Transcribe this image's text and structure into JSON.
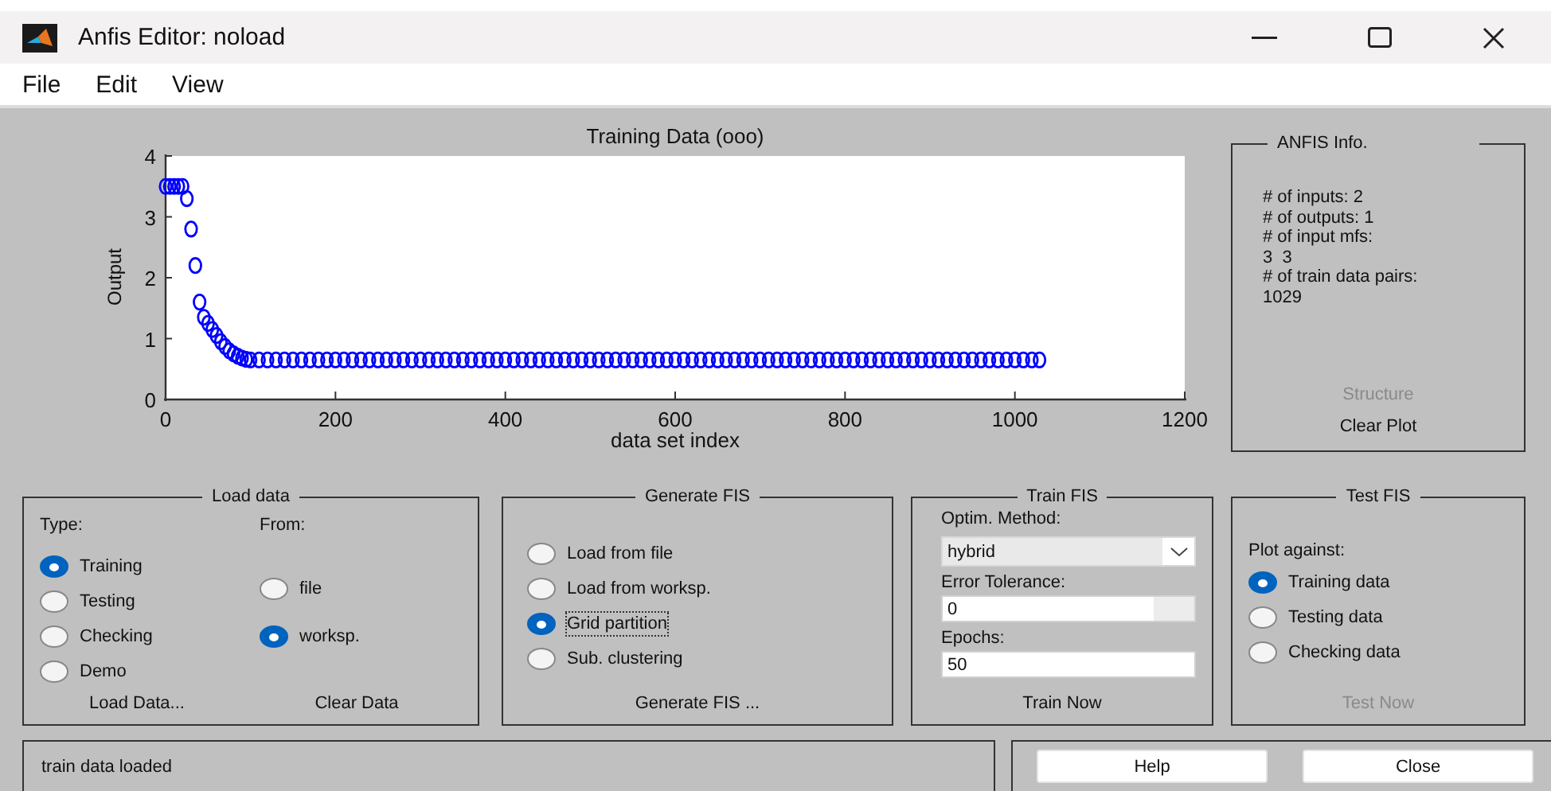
{
  "window": {
    "title": "Anfis Editor: noload"
  },
  "menu": [
    "File",
    "Edit",
    "View"
  ],
  "plot": {
    "chart_data": {
      "type": "scatter",
      "title": "Training Data (ooo)",
      "xlabel": "data set index",
      "ylabel": "Output",
      "xlim": [
        0,
        1200
      ],
      "ylim": [
        0,
        4
      ],
      "xticks": [
        0,
        200,
        400,
        600,
        800,
        1000,
        1200
      ],
      "yticks": [
        0,
        1,
        2,
        3,
        4
      ],
      "x": [
        0,
        5,
        10,
        15,
        20,
        25,
        30,
        35,
        40,
        45,
        50,
        55,
        60,
        65,
        70,
        75,
        80,
        85,
        90,
        95,
        100,
        110,
        120,
        130,
        140,
        150,
        160,
        170,
        180,
        190,
        200,
        210,
        220,
        230,
        240,
        250,
        260,
        270,
        280,
        290,
        300,
        310,
        320,
        330,
        340,
        350,
        360,
        370,
        380,
        390,
        400,
        410,
        420,
        430,
        440,
        450,
        460,
        470,
        480,
        490,
        500,
        510,
        520,
        530,
        540,
        550,
        560,
        570,
        580,
        590,
        600,
        610,
        620,
        630,
        640,
        650,
        660,
        670,
        680,
        690,
        700,
        710,
        720,
        730,
        740,
        750,
        760,
        770,
        780,
        790,
        800,
        810,
        820,
        830,
        840,
        850,
        860,
        870,
        880,
        890,
        900,
        910,
        920,
        930,
        940,
        950,
        960,
        970,
        980,
        990,
        1000,
        1010,
        1020,
        1029
      ],
      "series": [
        {
          "color": "#0000ff",
          "values": [
            3.5,
            3.5,
            3.5,
            3.5,
            3.5,
            3.3,
            2.8,
            2.2,
            1.6,
            1.35,
            1.25,
            1.15,
            1.05,
            0.95,
            0.87,
            0.8,
            0.75,
            0.71,
            0.68,
            0.66,
            0.65,
            0.65,
            0.65,
            0.65,
            0.65,
            0.65,
            0.65,
            0.65,
            0.65,
            0.65,
            0.65,
            0.65,
            0.65,
            0.65,
            0.65,
            0.65,
            0.65,
            0.65,
            0.65,
            0.65,
            0.65,
            0.65,
            0.65,
            0.65,
            0.65,
            0.65,
            0.65,
            0.65,
            0.65,
            0.65,
            0.65,
            0.65,
            0.65,
            0.65,
            0.65,
            0.65,
            0.65,
            0.65,
            0.65,
            0.65,
            0.65,
            0.65,
            0.65,
            0.65,
            0.65,
            0.65,
            0.65,
            0.65,
            0.65,
            0.65,
            0.65,
            0.65,
            0.65,
            0.65,
            0.65,
            0.65,
            0.65,
            0.65,
            0.65,
            0.65,
            0.65,
            0.65,
            0.65,
            0.65,
            0.65,
            0.65,
            0.65,
            0.65,
            0.65,
            0.65,
            0.65,
            0.65,
            0.65,
            0.65,
            0.65,
            0.65,
            0.65,
            0.65,
            0.65,
            0.65,
            0.65,
            0.65,
            0.65,
            0.65,
            0.65,
            0.65,
            0.65,
            0.65,
            0.65,
            0.65,
            0.65,
            0.65,
            0.65,
            0.65
          ]
        }
      ]
    }
  },
  "anfis_info": {
    "title": "ANFIS Info.",
    "lines": [
      "# of inputs: 2",
      "# of outputs: 1",
      "# of input mfs:",
      "3  3",
      "# of train data pairs:",
      "1029"
    ],
    "buttons": [
      {
        "label": "Structure",
        "disabled": true
      },
      {
        "label": "Clear Plot",
        "disabled": false
      }
    ]
  },
  "load_data": {
    "title": "Load data",
    "type_label": "Type:",
    "types": [
      {
        "label": "Training",
        "selected": true
      },
      {
        "label": "Testing",
        "selected": false
      },
      {
        "label": "Checking",
        "selected": false
      },
      {
        "label": "Demo",
        "selected": false
      }
    ],
    "from_label": "From:",
    "sources": [
      {
        "label": "file",
        "selected": false
      },
      {
        "label": "worksp.",
        "selected": true
      }
    ],
    "buttons": [
      {
        "label": "Load Data...",
        "disabled": false
      },
      {
        "label": "Clear Data",
        "disabled": false
      }
    ]
  },
  "generate_fis": {
    "title": "Generate FIS",
    "options": [
      {
        "label": "Load from file",
        "selected": false,
        "focused": false
      },
      {
        "label": "Load from worksp.",
        "selected": false,
        "focused": false
      },
      {
        "label": "Grid partition",
        "selected": true,
        "focused": true
      },
      {
        "label": "Sub. clustering",
        "selected": false,
        "focused": false
      }
    ],
    "button": {
      "label": "Generate FIS ...",
      "disabled": false
    }
  },
  "train_fis": {
    "title": "Train FIS",
    "method_label": "Optim. Method:",
    "method": "hybrid",
    "tolerance_label": "Error Tolerance:",
    "tolerance": "0",
    "epochs_label": "Epochs:",
    "epochs": "50",
    "button": {
      "label": "Train Now",
      "disabled": false
    }
  },
  "test_fis": {
    "title": "Test FIS",
    "plot_label": "Plot against:",
    "options": [
      {
        "label": "Training data",
        "selected": true
      },
      {
        "label": "Testing data",
        "selected": false
      },
      {
        "label": "Checking data",
        "selected": false
      }
    ],
    "button": {
      "label": "Test Now",
      "disabled": true
    }
  },
  "status": "train data loaded",
  "buttons": [
    {
      "label": "Help"
    },
    {
      "label": "Close"
    }
  ]
}
